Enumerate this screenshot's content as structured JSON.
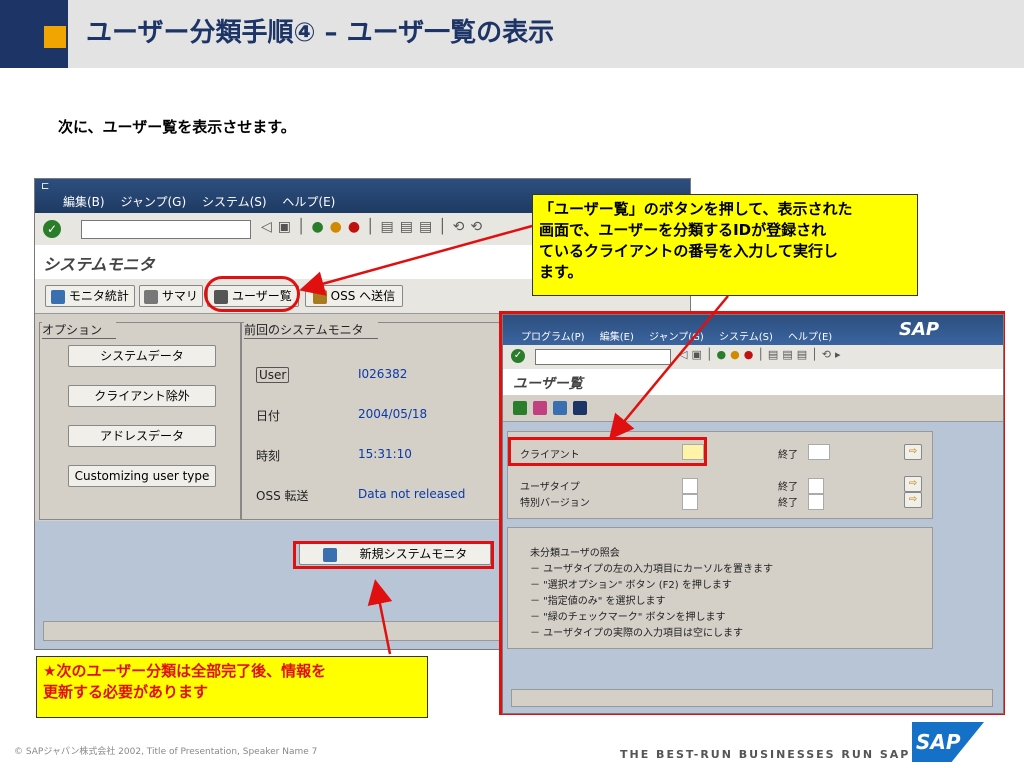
{
  "slide": {
    "title": "ユーザー分類手順④ – ユーザ一覧の表示",
    "subtitle": "次に、ユーザー覧を表示させます。",
    "footer_left": "©  SAPジャパン株式会社 2002, Title of Presentation, Speaker Name  7",
    "footer_right": "THE BEST-RUN BUSINESSES RUN SAP",
    "logo_text": "SAP"
  },
  "window1": {
    "menu": [
      "編集(B)",
      "ジャンプ(G)",
      "システム(S)",
      "ヘルプ(E)"
    ],
    "screen_title": "システムモニタ",
    "app_toolbar": [
      "モニタ統計",
      "サマリ",
      "ユーザー覧",
      "OSS へ送信"
    ],
    "options_tab": "オプション",
    "option_buttons": [
      "システムデータ",
      "クライアント除外",
      "アドレスデータ",
      "Customizing user type"
    ],
    "prev_tab": "前回のシステムモニタ",
    "fields": [
      {
        "label": "User",
        "value": "I026382"
      },
      {
        "label": "日付",
        "value": "2004/05/18"
      },
      {
        "label": "時刻",
        "value": "15:31:10"
      },
      {
        "label": "OSS 転送",
        "value": "Data not released"
      }
    ],
    "new_monitor_button": "新規システムモニタ"
  },
  "window2": {
    "menu": [
      "プログラム(P)",
      "編集(E)",
      "ジャンプ(G)",
      "システム(S)",
      "ヘルプ(E)"
    ],
    "screen_title": "ユーザー覧",
    "rows": [
      {
        "label": "クライアント",
        "to": "終了"
      },
      {
        "label": "ユーザタイプ",
        "to": "終了"
      },
      {
        "label": "特別バージョン",
        "to": "終了"
      }
    ],
    "info_lines": [
      "未分類ユーザの照会",
      "－ ユーザタイプの左の入力項目にカーソルを置きます",
      "－ \"選択オプション\" ボタン (F2) を押します",
      "－ \"指定値のみ\" を選択します",
      "－ \"緑のチェックマーク\" ボタンを押します",
      "－ ユーザタイプの実際の入力項目は空にします"
    ]
  },
  "callouts": {
    "top": [
      "「ユーザー覧」のボタンを押して、表示された",
      "画面で、ユーザーを分類するIDが登録され",
      "ているクライアントの番号を入力して実行し",
      "ます。"
    ],
    "bottom": [
      "★次のユーザー分類は全部完了後、情報を",
      "更新する必要があります"
    ]
  },
  "colors": {
    "header_blue": "#1d3467",
    "accent_orange": "#f0a500",
    "highlight_red": "#e01010",
    "callout_yellow": "#ffff00"
  }
}
